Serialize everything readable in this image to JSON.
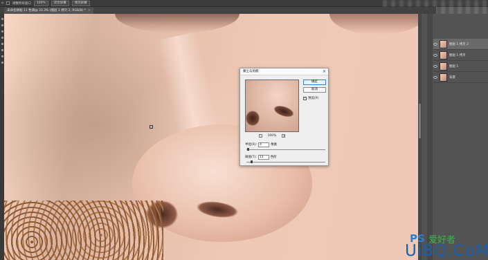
{
  "options_bar": {
    "items": [
      "调整所有窗口",
      "100%",
      "适合屏幕",
      "填充屏幕"
    ]
  },
  "document_tab": {
    "label": "未命名拼贴 11 色调@ 33.3% (图层 1 拷贝 2, RGB/8) *",
    "close": "×"
  },
  "layers": [
    {
      "name": "图层 1 拷贝 2",
      "selected": true
    },
    {
      "name": "图层 1 拷贝",
      "selected": false
    },
    {
      "name": "图层 1",
      "selected": false
    },
    {
      "name": "背景",
      "selected": false
    }
  ],
  "dialog": {
    "title": "蒙尘与划痕",
    "close": "×",
    "ok_label": "确定",
    "cancel_label": "取消",
    "preview_label": "预览(P)",
    "preview_checked": "✓",
    "zoom_level": "100%",
    "zoom_out": "-",
    "zoom_in": "+",
    "radius_label": "半径(R):",
    "radius_value": "4",
    "radius_unit": "像素",
    "threshold_label": "阈值(T):",
    "threshold_value": "13",
    "threshold_unit": "色阶"
  },
  "watermark": {
    "ps": "PS",
    "cn": "爱好者",
    "com": "UiBQ.CoM"
  }
}
